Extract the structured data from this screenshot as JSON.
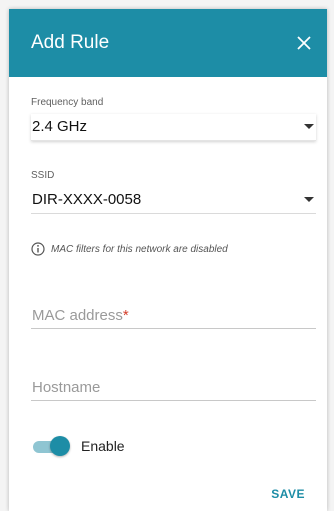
{
  "dialog": {
    "title": "Add Rule",
    "close_icon": "close-icon",
    "colors": {
      "header": "#1d8da6",
      "accent": "#1d8da6",
      "required": "#d43d2a"
    }
  },
  "frequency_band": {
    "label": "Frequency band",
    "value": "2.4 GHz"
  },
  "ssid": {
    "label": "SSID",
    "value": "DIR-XXXX-0058"
  },
  "info": {
    "icon": "info-icon",
    "text": "MAC filters for this network are disabled"
  },
  "mac_address": {
    "placeholder": "MAC address",
    "required_mark": "*"
  },
  "hostname": {
    "placeholder": "Hostname"
  },
  "enable_toggle": {
    "label": "Enable",
    "checked": true
  },
  "save_label": "SAVE"
}
